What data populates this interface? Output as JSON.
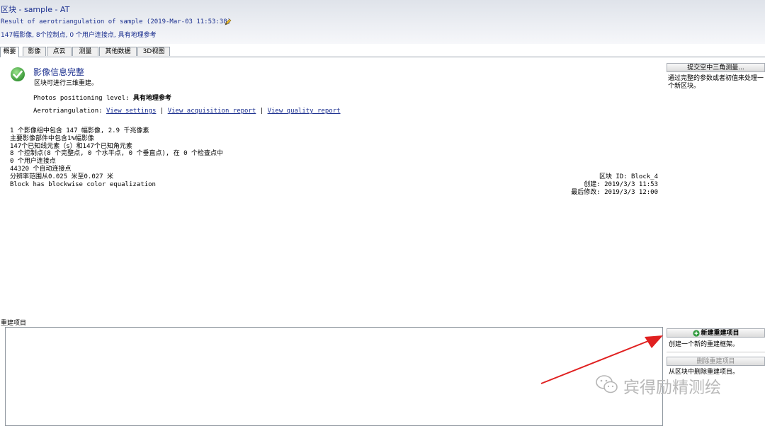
{
  "header": {
    "title": "区块 - sample - AT",
    "subtitle": "Result of aerotriangulation of sample (2019-Mar-03 11:53:38)",
    "summary": "147幅影像, 8个控制点, 0 个用户连接点, 具有地理参考"
  },
  "tabs": [
    {
      "label": "概要",
      "active": true
    },
    {
      "label": "影像",
      "active": false
    },
    {
      "label": "点云",
      "active": false
    },
    {
      "label": "测量",
      "active": false
    },
    {
      "label": "其他数据",
      "active": false
    },
    {
      "label": "3D视图",
      "active": false
    }
  ],
  "status": {
    "title": "影像信息完整",
    "subtitle": "区块可进行三维重建。",
    "positioning_label": "Photos positioning level:",
    "positioning_value": "具有地理参考",
    "at_label": "Aerotriangulation:",
    "link_settings": "View settings",
    "link_acquisition": "View acquisition report",
    "link_quality": "View quality report",
    "separator": "|"
  },
  "stats": [
    "1 个影像组中包含 147 幅影像, 2.9 千兆像素",
    "主要影像部件中包含1%幅影像",
    "147个已知线元素（s）和147个已知角元素",
    "8 个控制点(8 个完整点, 0 个水平点, 0 个垂直点), 在 0 个检查点中",
    "0 个用户连接点",
    "44320 个自动连接点",
    "分辨率范围从0.025 米至0.027 米",
    "Block has blockwise color equalization"
  ],
  "block_meta": {
    "id": "区块 ID: Block_4",
    "created": "创建: 2019/3/3 11:53",
    "modified": "最后修改: 2019/3/3 12:00"
  },
  "side": {
    "submit_at_label": "提交空中三角测量...",
    "submit_at_desc_1": "通过完整的参数或者初值来处理一",
    "submit_at_desc_2": "个新区块。",
    "new_recon_label": "新建重建项目",
    "new_recon_desc": "创建一个新的重建框架。",
    "delete_recon_label": "删除重建项目",
    "delete_recon_desc": "从区块中删除重建项目。"
  },
  "reconstruction": {
    "label": "重建项目"
  },
  "watermark": {
    "text": "宾得励精测绘"
  },
  "colors": {
    "accent": "#1b2f8f",
    "check": "#3aa33a",
    "arrow": "#e02020"
  }
}
